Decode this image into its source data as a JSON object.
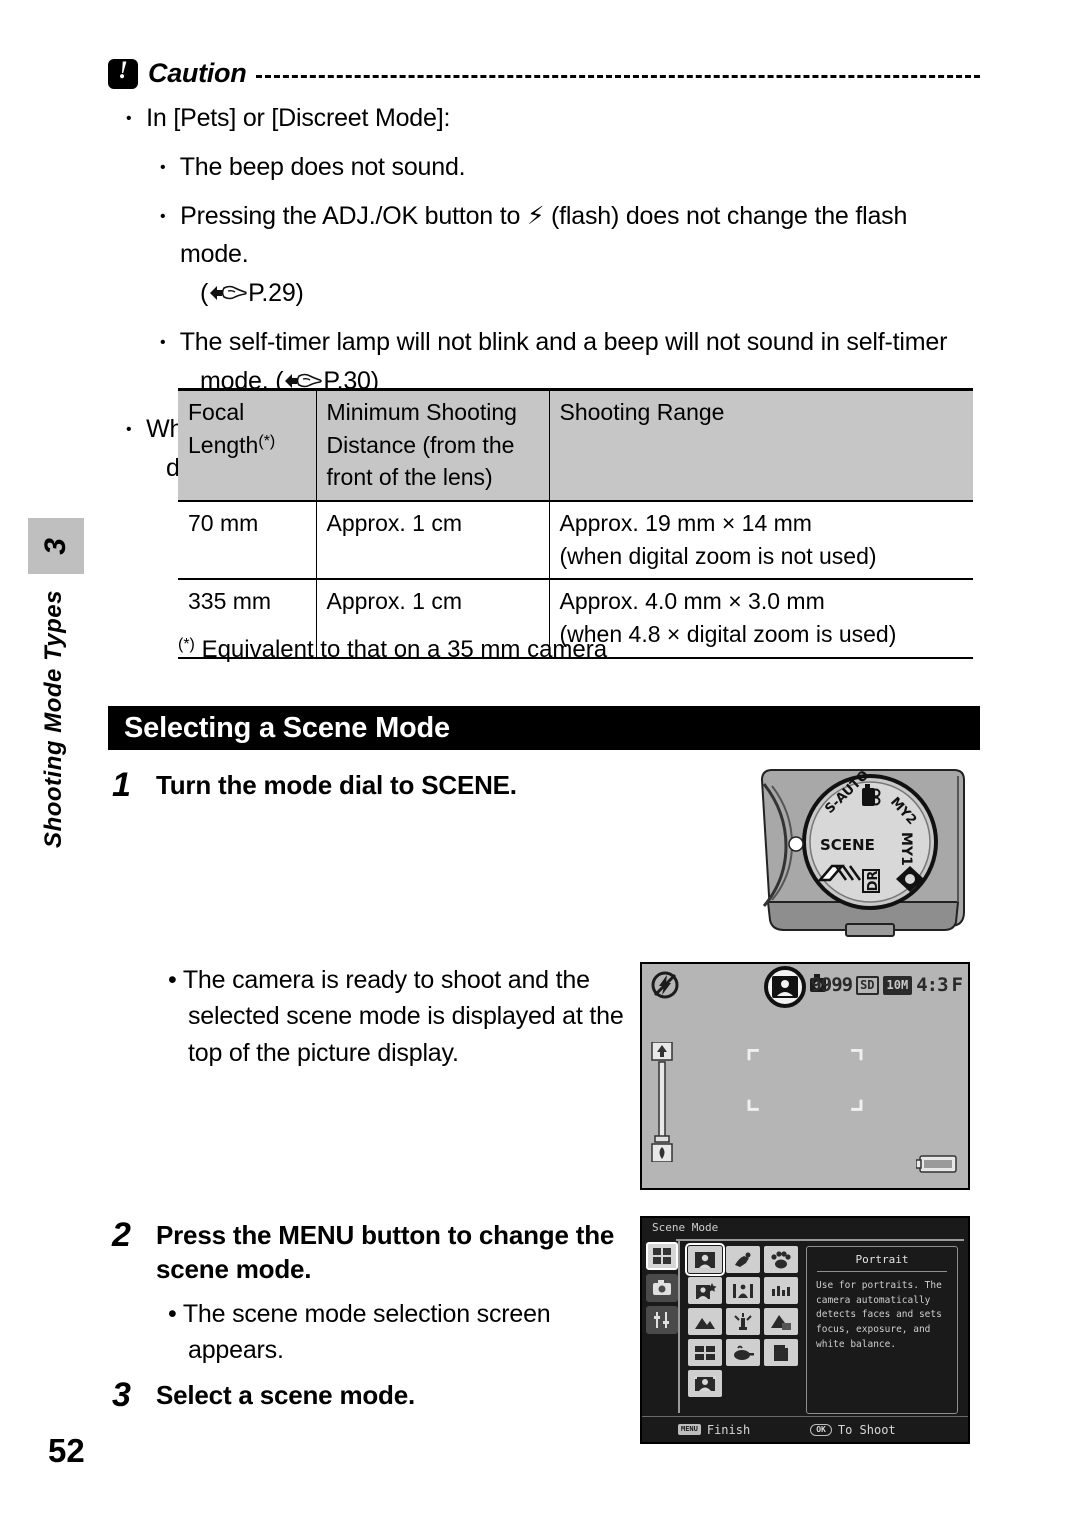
{
  "chapter": {
    "number": "3",
    "label": "Shooting Mode Types"
  },
  "page_number": "52",
  "caution": {
    "title": "Caution",
    "icon": "caution-icon",
    "bullets": {
      "b1": "In [Pets] or [Discreet Mode]:",
      "b2": "The beep does not sound.",
      "b3_pre": "Pressing the ADJ./OK button to",
      "b3_icon": "⚡",
      "b3_post": "(flash) does not change the flash mode.",
      "b3_ref": "P.29",
      "b4": "The self-timer lamp will not blink and a beep will not sound in self-timer",
      "b4_cont": "mode. (",
      "b4_ref": "P.30",
      "b4_end": ")",
      "b5": "When using [Zoom Macro], you can shoot close-ups within the following",
      "b5_cont": "distances:"
    }
  },
  "spec_table": {
    "headers": [
      "Focal Length",
      "Minimum Shooting Distance (from the front of the lens)",
      "Shooting Range"
    ],
    "header_parts": {
      "h1_line1": "Focal",
      "h1_line2": "Length",
      "h1_sup": "(*)",
      "h2_line1": "Minimum Shooting",
      "h2_line2": "Distance (from the",
      "h2_line3": "front of the lens)",
      "h3": "Shooting Range"
    },
    "rows": [
      {
        "focal_length": "70 mm",
        "min_distance": "Approx. 1 cm",
        "range_main": "Approx. 19 mm × 14 mm",
        "range_note": "(when digital zoom is not used)"
      },
      {
        "focal_length": "335 mm",
        "min_distance": "Approx. 1 cm",
        "range_main": "Approx. 4.0 mm × 3.0 mm",
        "range_note": "(when 4.8 × digital zoom is used)"
      }
    ],
    "note_sup": "(*)",
    "note": "Equivalent to that on a 35 mm camera"
  },
  "section": {
    "heading": "Selecting a Scene Mode"
  },
  "steps": {
    "step1": {
      "number": "1",
      "text": "Turn the mode dial to SCENE."
    },
    "step1_note": "The camera is ready to shoot and the selected scene mode is displayed at the top of the picture display.",
    "step2": {
      "number": "2",
      "text": "Press the MENU button to change the scene mode."
    },
    "step2_note": "The scene mode selection screen appears.",
    "step3": {
      "number": "3",
      "text": "Select a scene mode."
    }
  },
  "mode_dial": {
    "labels": {
      "scene": "SCENE",
      "s_auto": "S-AUTO",
      "my1": "MY1",
      "my2": "MY2",
      "dr": "DR"
    },
    "icons": [
      "movie-icon",
      "aperture-icon",
      "continuous-icon"
    ]
  },
  "lcd_display": {
    "flash_icon": "flash-off-icon",
    "scene_icon": "portrait-scene-icon",
    "card_icon": "internal-memory-icon",
    "shots_remaining": "9999",
    "card_label": "SD",
    "pixels_label": "10M",
    "aspect_label": "4:3",
    "quality_label": "F",
    "zoom_icon": "zoom-slider",
    "battery_icon": "battery-icon"
  },
  "scene_screen": {
    "title": "Scene Mode",
    "tabs": [
      "scene-tab",
      "shooting-tab",
      "setup-tab"
    ],
    "selected_mode": "Portrait",
    "description": "Use for portraits. The camera automatically detects faces and sets focus, exposure, and white balance.",
    "grid_icons": [
      "portrait-icon",
      "sports-icon",
      "pets-icon",
      "nightportrait-icon",
      "night-landscape-icon",
      "discreet-icon",
      "landscape-icon",
      "highsens-icon",
      "zoom-macro-icon",
      "skew-correct-icon",
      "cooking-icon",
      "text-icon",
      "group-portrait-icon"
    ],
    "footer": {
      "menu_key": "MENU",
      "menu_label": "Finish",
      "ok_key": "OK",
      "ok_label": "To Shoot"
    }
  }
}
